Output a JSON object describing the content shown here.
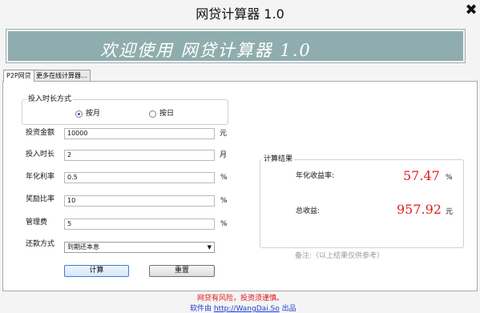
{
  "window": {
    "title": "网贷计算器 1.0",
    "close_glyph": "✖"
  },
  "banner": {
    "text": "欢迎使用  网贷计算器  1.0"
  },
  "tabs": [
    {
      "label": "P2P网贷",
      "active": true
    },
    {
      "label": "更多在线计算器…",
      "active": false
    }
  ],
  "investment_period": {
    "legend": "投入时长方式",
    "options": [
      {
        "label": "按月",
        "checked": true
      },
      {
        "label": "按日",
        "checked": false
      }
    ]
  },
  "fields": [
    {
      "label": "投资金额",
      "value": "10000",
      "unit": "元"
    },
    {
      "label": "投入时长",
      "value": "2",
      "unit": "月"
    },
    {
      "label": "年化利率",
      "value": "0.5",
      "unit": "%"
    },
    {
      "label": "奖励比率",
      "value": "10",
      "unit": "%"
    },
    {
      "label": "管理费",
      "value": "5",
      "unit": "%"
    }
  ],
  "repayment": {
    "label": "还款方式",
    "selected": "到期还本息"
  },
  "buttons": {
    "calculate": "计算",
    "reset": "重置"
  },
  "results": {
    "legend": "计算结果",
    "annual_label": "年化收益率:",
    "annual_value": "57.47",
    "annual_unit": "%",
    "total_label": "总收益:",
    "total_value": "957.92",
    "total_unit": "元",
    "note": "备注:（以上结果仅供参考）"
  },
  "footer": {
    "warning": "网贷有风险，投资须谨慎。",
    "credit_prefix": "软件由",
    "credit_link": "http://WangDai.So",
    "credit_suffix": "出品"
  },
  "colors": {
    "banner_bg": "#8fadae",
    "result_red": "#e31c1c",
    "warning_red": "#e0141c",
    "link_blue": "#1d3fd0"
  }
}
